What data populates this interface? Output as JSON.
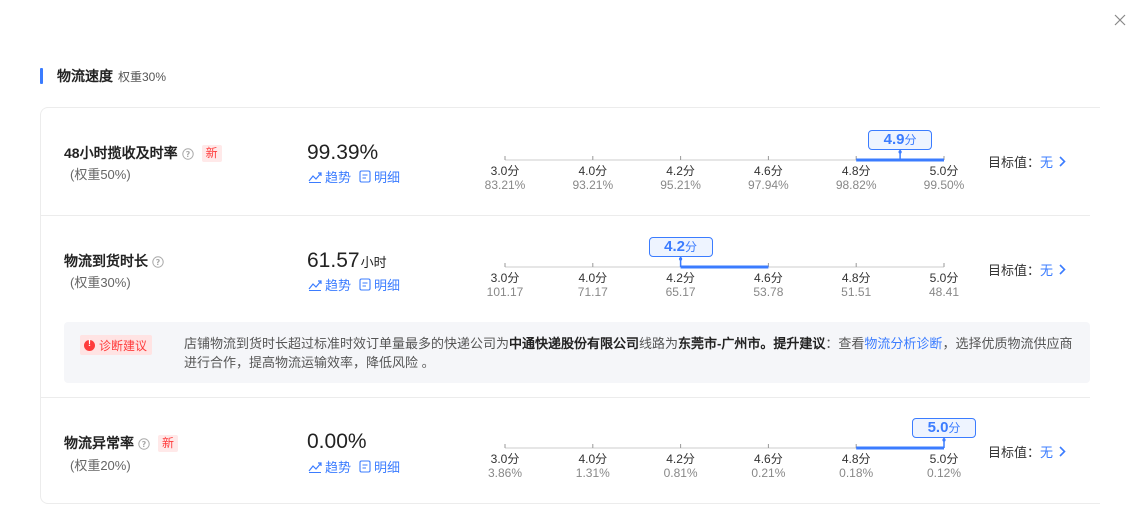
{
  "close_label": "×",
  "section": {
    "title": "物流速度",
    "weight": "权重30%"
  },
  "links": {
    "trend": "趋势",
    "detail": "明细"
  },
  "target": {
    "label": "目标值：",
    "value": "无"
  },
  "metrics": [
    {
      "name": "48小时揽收及时率",
      "is_new": true,
      "new_label": "新",
      "weight": "(权重50%)",
      "value": "99.39%",
      "unit": "",
      "score": "4.9",
      "score_unit": "分",
      "score_number": 4.9,
      "ticks": [
        {
          "score": "3.0分",
          "value": "83.21%"
        },
        {
          "score": "4.0分",
          "value": "93.21%"
        },
        {
          "score": "4.2分",
          "value": "95.21%"
        },
        {
          "score": "4.6分",
          "value": "97.94%"
        },
        {
          "score": "4.8分",
          "value": "98.82%"
        },
        {
          "score": "5.0分",
          "value": "99.50%"
        }
      ],
      "highlight_range": [
        4,
        5
      ]
    },
    {
      "name": "物流到货时长",
      "is_new": false,
      "new_label": "",
      "weight": "(权重30%)",
      "value": "61.57",
      "unit": "小时",
      "score": "4.2",
      "score_unit": "分",
      "score_number": 4.2,
      "ticks": [
        {
          "score": "3.0分",
          "value": "101.17"
        },
        {
          "score": "4.0分",
          "value": "71.17"
        },
        {
          "score": "4.2分",
          "value": "65.17"
        },
        {
          "score": "4.6分",
          "value": "53.78"
        },
        {
          "score": "4.8分",
          "value": "51.51"
        },
        {
          "score": "5.0分",
          "value": "48.41"
        }
      ],
      "highlight_range": [
        2,
        3
      ]
    },
    {
      "name": "物流异常率",
      "is_new": true,
      "new_label": "新",
      "weight": "(权重20%)",
      "value": "0.00%",
      "unit": "",
      "score": "5.0",
      "score_unit": "分",
      "score_number": 5.0,
      "ticks": [
        {
          "score": "3.0分",
          "value": "3.86%"
        },
        {
          "score": "4.0分",
          "value": "1.31%"
        },
        {
          "score": "4.2分",
          "value": "0.81%"
        },
        {
          "score": "4.6分",
          "value": "0.21%"
        },
        {
          "score": "4.8分",
          "value": "0.18%"
        },
        {
          "score": "5.0分",
          "value": "0.12%"
        }
      ],
      "highlight_range": [
        4,
        5
      ]
    }
  ],
  "diagnosis": {
    "badge": "诊断建议",
    "text_1": "店铺物流到货时长超过标准时效订单量最多的快递公司为",
    "company": "中通快递股份有限公司",
    "text_2": "线路为",
    "route": "东莞市-广州市。",
    "suggest_label": "提升建议",
    "text_3": "：查看",
    "link": "物流分析诊断",
    "text_4": "，选择优质物流供应商进行合作，提高物流运输效率，降低风险 。"
  },
  "colors": {
    "accent": "#3b7cff",
    "danger": "#ff3b3b",
    "axis": "#cccccc"
  }
}
